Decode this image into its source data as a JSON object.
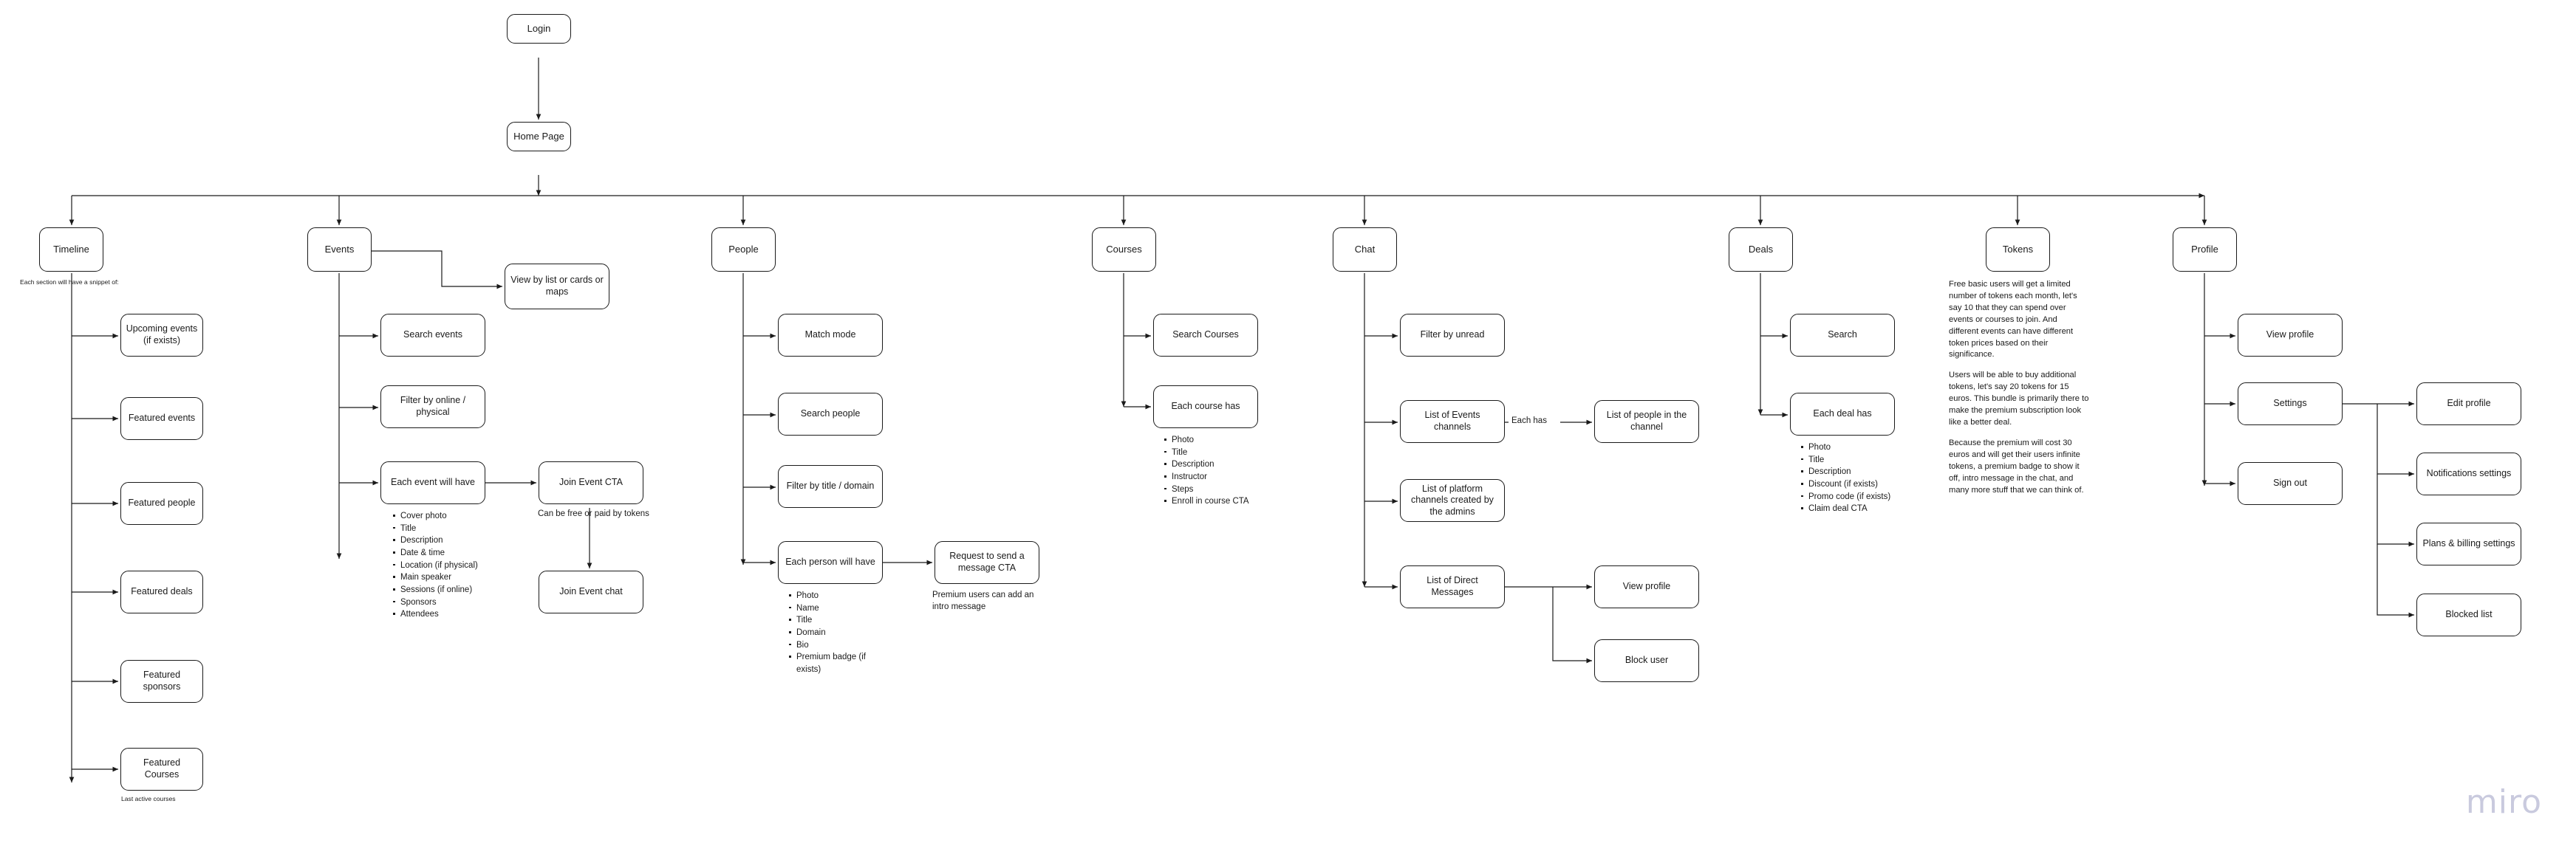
{
  "diagram": {
    "title": "Login",
    "watermark": "miro"
  },
  "root": {
    "login": "Login",
    "home_page": "Home Page"
  },
  "columns": {
    "timeline": {
      "label": "Timeline",
      "caption": "Each section will have a snippet of:",
      "footnote": "Last active courses",
      "items": [
        {
          "label": "Upcoming events\n(if exists)"
        },
        {
          "label": "Featured events"
        },
        {
          "label": "Featured people"
        },
        {
          "label": "Featured deals"
        },
        {
          "label": "Featured sponsors"
        },
        {
          "label": "Featured Courses"
        }
      ]
    },
    "events": {
      "label": "Events",
      "view_modes": "View by list or cards or maps",
      "search": "Search events",
      "filter": "Filter by online / physical",
      "each_event": "Each event will have",
      "each_event_bullets": [
        "Cover photo",
        "Title",
        "Description",
        "Date & time",
        "Location (if physical)",
        "Main speaker",
        "Sessions (if online)",
        "Sponsors",
        "Attendees"
      ],
      "join_cta": "Join Event CTA",
      "join_cta_note": "Can be free or paid by tokens",
      "join_chat": "Join Event chat"
    },
    "people": {
      "label": "People",
      "match_mode": "Match mode",
      "search": "Search people",
      "filter": "Filter by title / domain",
      "each_person": "Each person will have",
      "each_person_bullets": [
        "Photo",
        "Name",
        "Title",
        "Domain",
        "Bio",
        "Premium badge (if exists)"
      ],
      "request_cta": "Request to send a message CTA",
      "request_cta_note": "Premium users can add an intro message"
    },
    "courses": {
      "label": "Courses",
      "search": "Search Courses",
      "each_course": "Each course has",
      "each_course_bullets": [
        "Photo",
        "Title",
        "Description",
        "Instructor",
        "Steps",
        "Enroll in course CTA"
      ]
    },
    "chat": {
      "label": "Chat",
      "filter_unread": "Filter by unread",
      "events_channels": "List of Events channels",
      "each_has_label": "Each has",
      "people_in_channel": "List of people in the channel",
      "platform_channels": "List of platform channels created by the admins",
      "direct_messages": "List of Direct Messages",
      "view_profile": "View profile",
      "block_user": "Block user"
    },
    "deals": {
      "label": "Deals",
      "search": "Search",
      "each_deal": "Each deal has",
      "each_deal_bullets": [
        "Photo",
        "Title",
        "Description",
        "Discount (if exists)",
        "Promo code (if exists)",
        "Claim deal CTA"
      ]
    },
    "tokens": {
      "label": "Tokens",
      "paragraphs": [
        "Free basic users will get a limited number of tokens each month, let's say 10 that they can spend over events or courses to join. And different events can have different token prices based on their significance.",
        "Users will be able to buy additional tokens, let's say 20 tokens for 15 euros. This bundle is primarily there to make the premium subscription look like a better deal.",
        "Because the premium will cost 30 euros and will get their users infinite tokens, a premium badge to show it off, intro message in the chat, and many more stuff that we can think of."
      ]
    },
    "profile": {
      "label": "Profile",
      "view_profile": "View profile",
      "settings": "Settings",
      "sign_out": "Sign out",
      "settings_children": [
        {
          "label": "Edit profile"
        },
        {
          "label": "Notifications settings"
        },
        {
          "label": "Plans & billing settings"
        },
        {
          "label": "Blocked list"
        }
      ]
    }
  },
  "colors": {
    "stroke": "#1a1a1a",
    "background": "#ffffff",
    "watermark": "#c9cade"
  }
}
